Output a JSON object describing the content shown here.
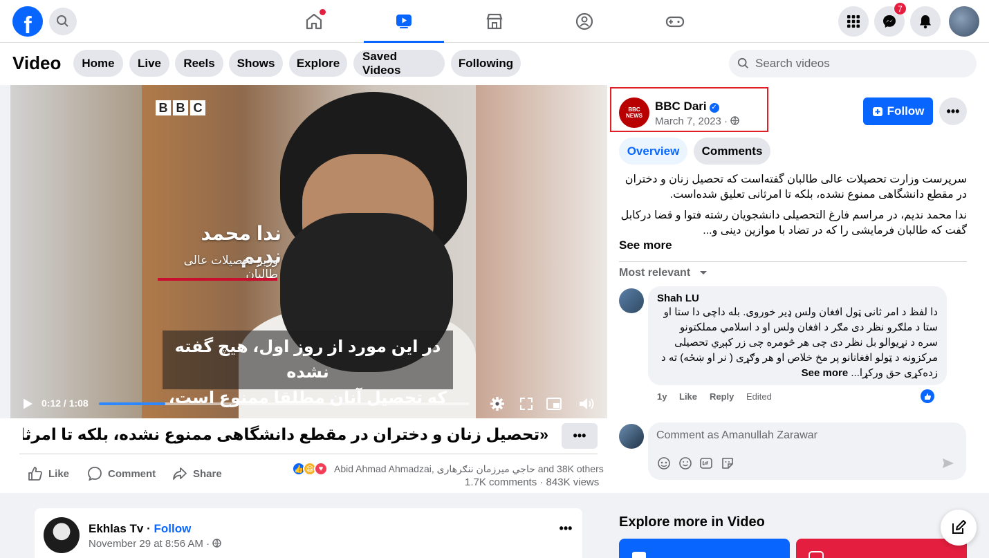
{
  "nav": {
    "logo": "f",
    "notifications_badge": "7",
    "tabs": [
      "home",
      "video",
      "marketplace",
      "groups",
      "gaming"
    ],
    "accent_color": "#0866ff"
  },
  "subnav": {
    "title": "Video",
    "pills": [
      "Home",
      "Live",
      "Reels",
      "Shows",
      "Explore",
      "Saved Videos",
      "Following"
    ],
    "search_placeholder": "Search videos"
  },
  "video": {
    "bbc_letters": [
      "B",
      "B",
      "C"
    ],
    "name_overlay": "ندا محمد ندیم",
    "title_overlay": "وزیر تحصیلات عالی طالبان",
    "subtitle_line1": "در این مورد از روز اول، هیچ گفته نشده",
    "subtitle_line2": "که تحصیل آنان مطلقا ممنوع است،",
    "time": "0:12 / 1:08",
    "progress": 0.18,
    "caption": "«تحصیل زنان و دختران در مقطع دانشگاهی ممنوع نشده، بلکه تا امرثانی تعلیق شد...",
    "actions": {
      "like": "Like",
      "comment": "Comment",
      "share": "Share"
    },
    "reactions_text": "Abid Ahmad Ahmadzai, حاجي ميرزمان ننګرهاری and 38K others ·",
    "stats": "1.7K comments · 843K views"
  },
  "post": {
    "page_avatar_lines": [
      "BBC",
      "NEWS"
    ],
    "page_name": "BBC Dari",
    "date": "March 7, 2023 ·",
    "follow_label": "Follow",
    "tabs": {
      "overview": "Overview",
      "comments": "Comments"
    },
    "desc_p1": "سرپرست وزارت تحصیلات عالی طالبان گفته‌است که تحصیل زنان و دختران در مقطع دانشگاهی ممنوع نشده، بلکه تا امرثانی تعلیق شده‌است.",
    "desc_p2": "ندا محمد ندیم، در مراسم فارغ التحصیلی دانشجویان رشته فتوا و قضا درکابل گفت که طالبان فرمایشی را که در تضاد با موازین دینی و...",
    "see_more": "See more",
    "sort_label": "Most relevant"
  },
  "comment": {
    "author": "Shah LU",
    "text": "دا لفظ د امر ثانی ټول افغان ولس ډیر خوروی. بله داچی دا ستا او ستا د ملګرو نظر دی مګر د افغان ولس او د اسلامي مملکتونو سره د نړیوالو بل نظر دی چی هر څومره چی زر کېږي تحصیلی مرکزونه د ټولو افغانانو پر مخ خلاص او هر وګړی ( نر او ښځه) ته د زده‌کړی حق ورکړا...",
    "see_more": "See more",
    "time": "1y",
    "like": "Like",
    "reply": "Reply",
    "edited": "Edited",
    "composer_placeholder": "Comment as Amanullah Zarawar"
  },
  "next_post": {
    "name": "Ekhlas Tv",
    "separator": " · ",
    "follow": "Follow",
    "date": "November 29 at 8:56 AM ·"
  },
  "explore": {
    "title": "Explore more in Video"
  }
}
